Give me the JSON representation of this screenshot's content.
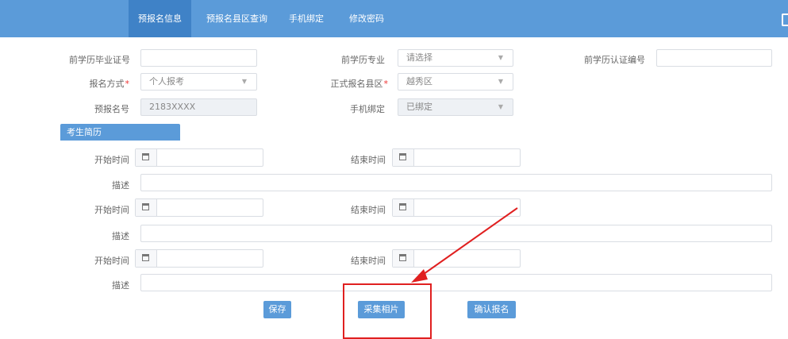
{
  "nav": {
    "items": [
      "预报名信息",
      "预报名县区查询",
      "手机绑定",
      "修改密码"
    ],
    "active": "预报名信息"
  },
  "form": {
    "prev_cert_no_label": "前学历毕业证号",
    "prev_major_label": "前学历专业",
    "prev_major_value": "请选择",
    "prev_auth_no_label": "前学历认证编号",
    "signup_method_label": "报名方式",
    "signup_method_value": "个人报考",
    "county_label": "正式报名县区",
    "county_value": "越秀区",
    "prereg_no_label": "预报名号",
    "prereg_no_value": "2183XXXX",
    "phone_bind_label": "手机绑定",
    "phone_bind_value": "已绑定",
    "required_mark": "*"
  },
  "resume": {
    "tab_label": "考生简历",
    "start_label": "开始时间",
    "end_label": "结束时间",
    "desc_label": "描述"
  },
  "buttons": {
    "save": "保存",
    "capture_photo": "采集相片",
    "confirm": "确认报名"
  },
  "colors": {
    "header": "#5b9bd9",
    "nav_active": "#3f82c7",
    "annotation": "#e02020"
  },
  "select_arrow": "▼"
}
